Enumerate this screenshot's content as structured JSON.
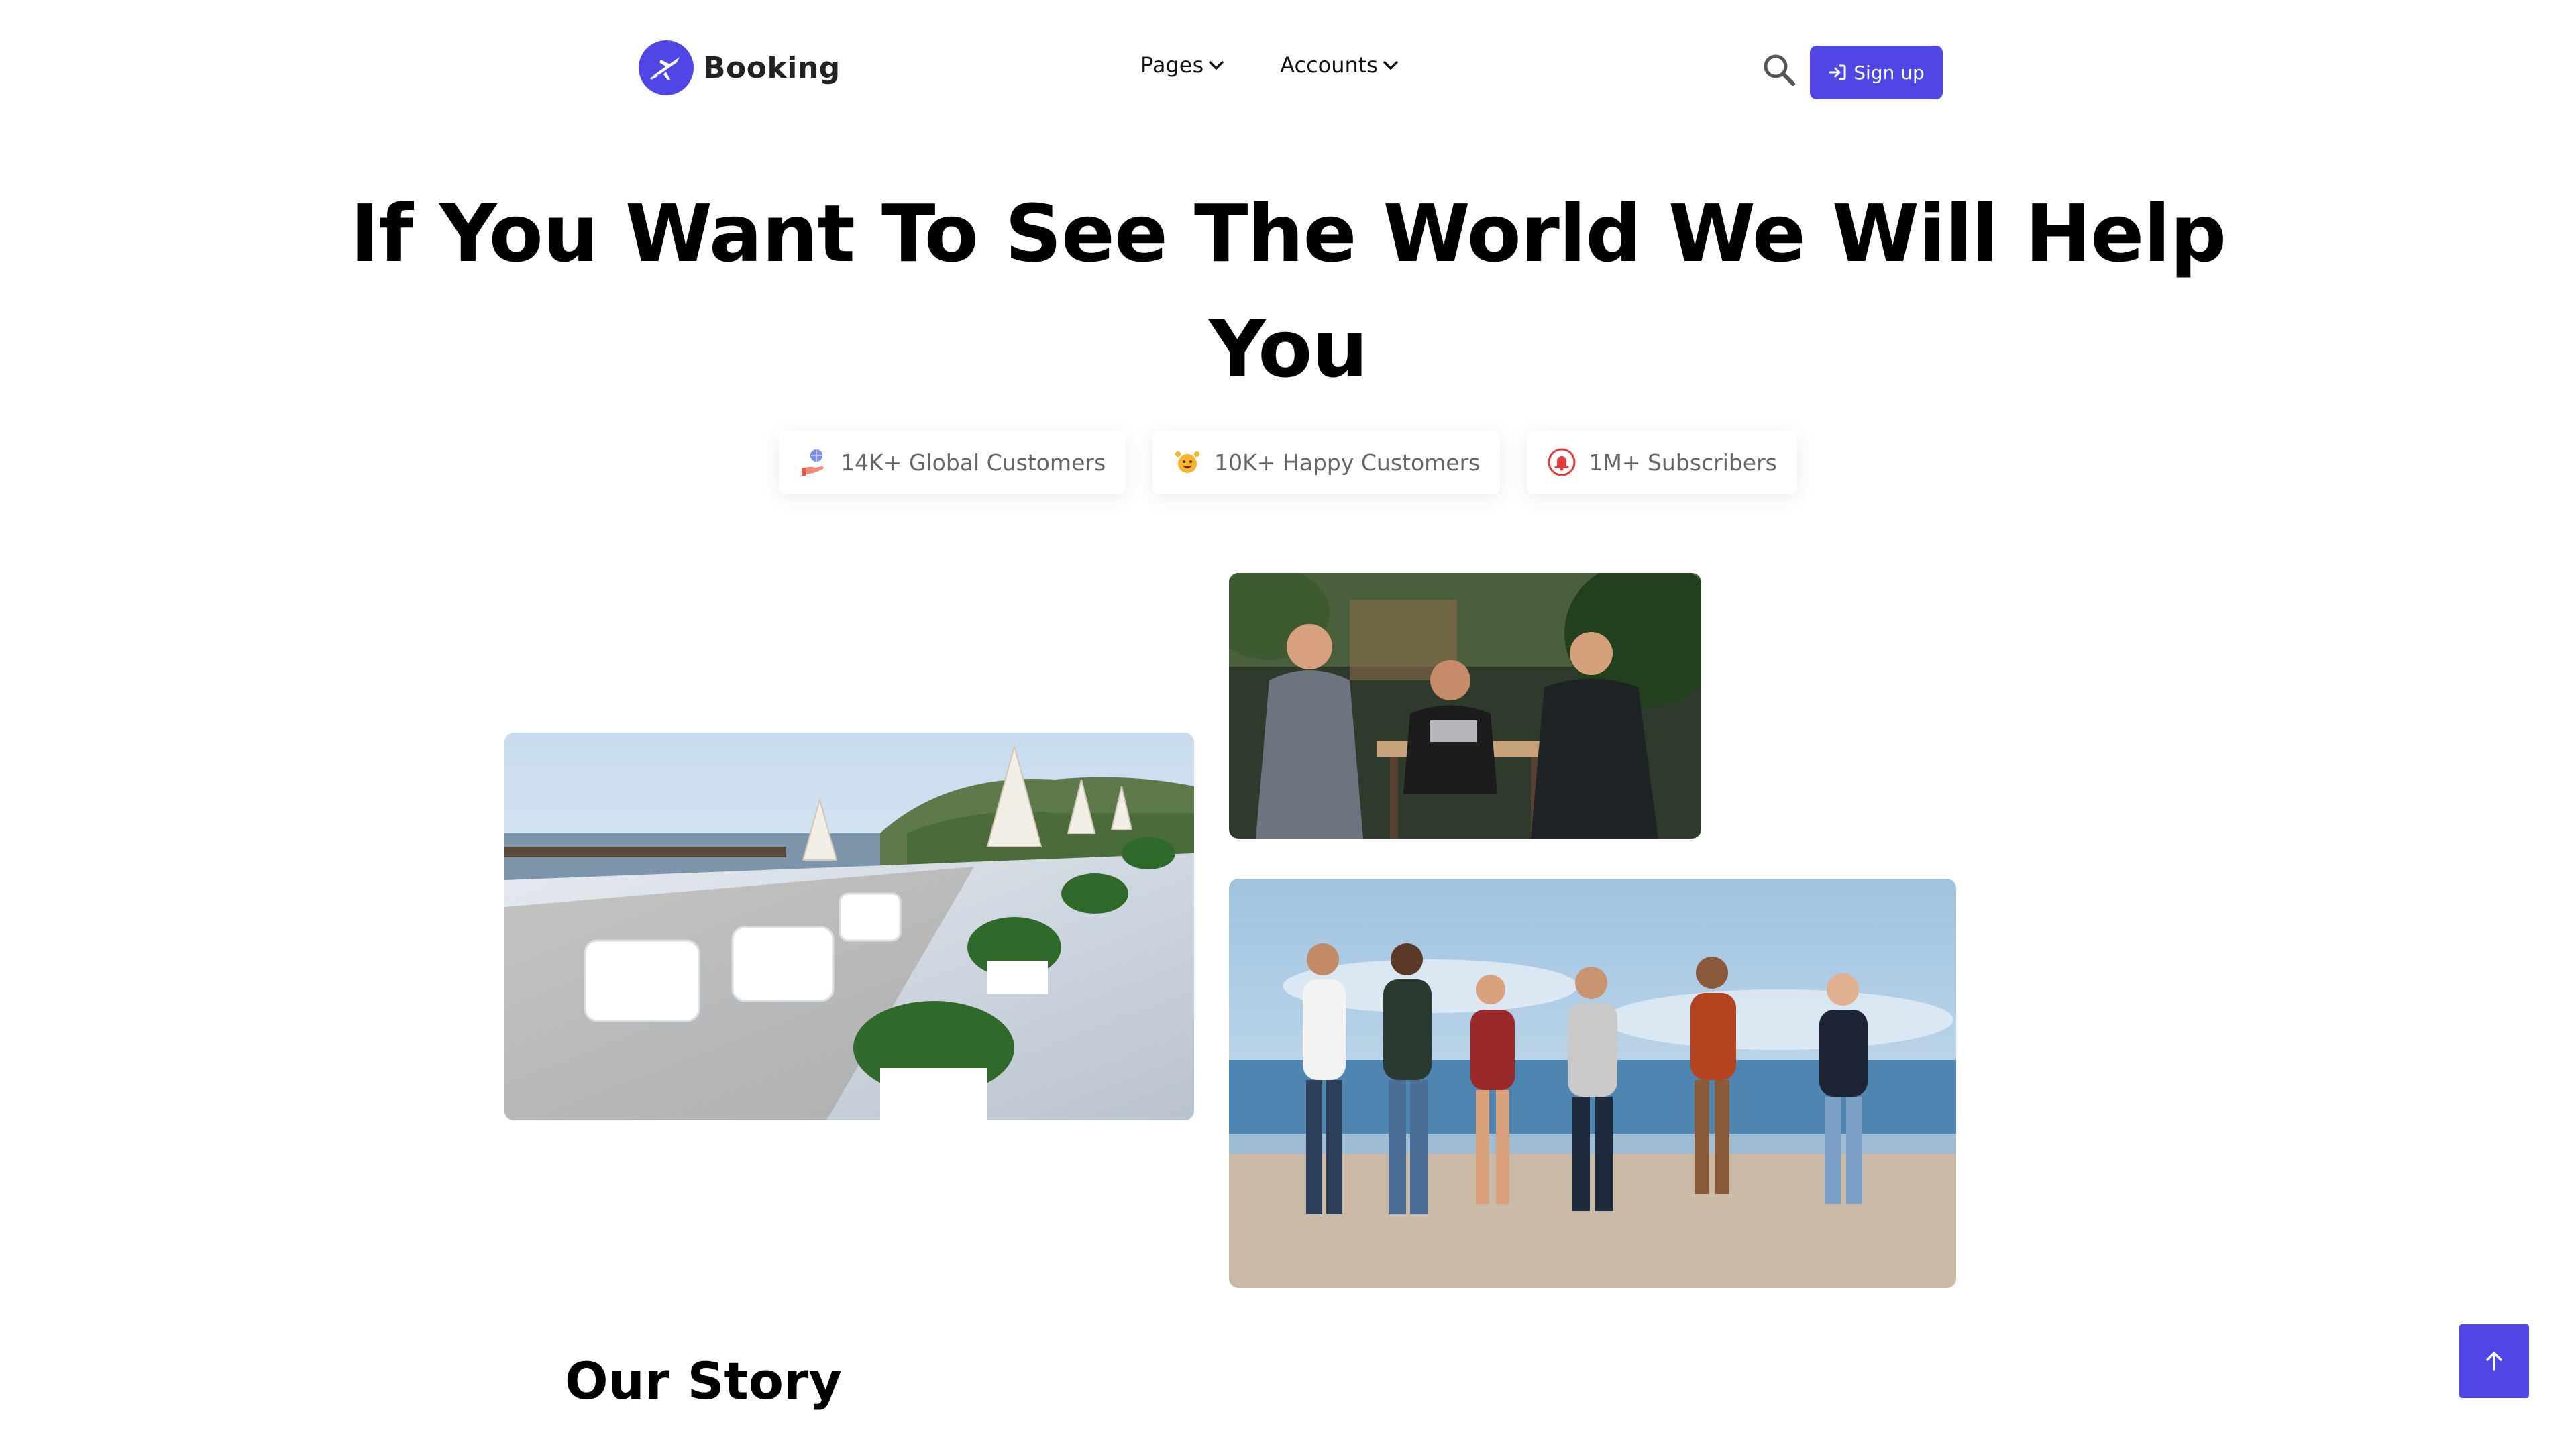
{
  "brand": {
    "name": "Booking",
    "accent": "#5046e5"
  },
  "nav": {
    "items": [
      {
        "label": "Pages",
        "icon": "chevron-down-icon"
      },
      {
        "label": "Accounts",
        "icon": "chevron-down-icon"
      }
    ]
  },
  "header": {
    "search_icon": "search-icon",
    "signup_label": "Sign up",
    "signup_icon": "sign-in-icon"
  },
  "hero": {
    "title_line1": "If You Want To See The World We Will Help",
    "title_line2": "You",
    "stats": [
      {
        "label": "14K+ Global Customers",
        "icon": "globe-hand-icon"
      },
      {
        "label": "10K+ Happy Customers",
        "icon": "happy-face-icon"
      },
      {
        "label": "1M+ Subscribers",
        "icon": "bell-icon"
      }
    ]
  },
  "gallery": {
    "images": [
      "resort-deck-image",
      "cafe-friends-image",
      "beach-friends-image"
    ]
  },
  "story": {
    "title": "Our Story"
  },
  "scroll_top_icon": "arrow-up-icon"
}
